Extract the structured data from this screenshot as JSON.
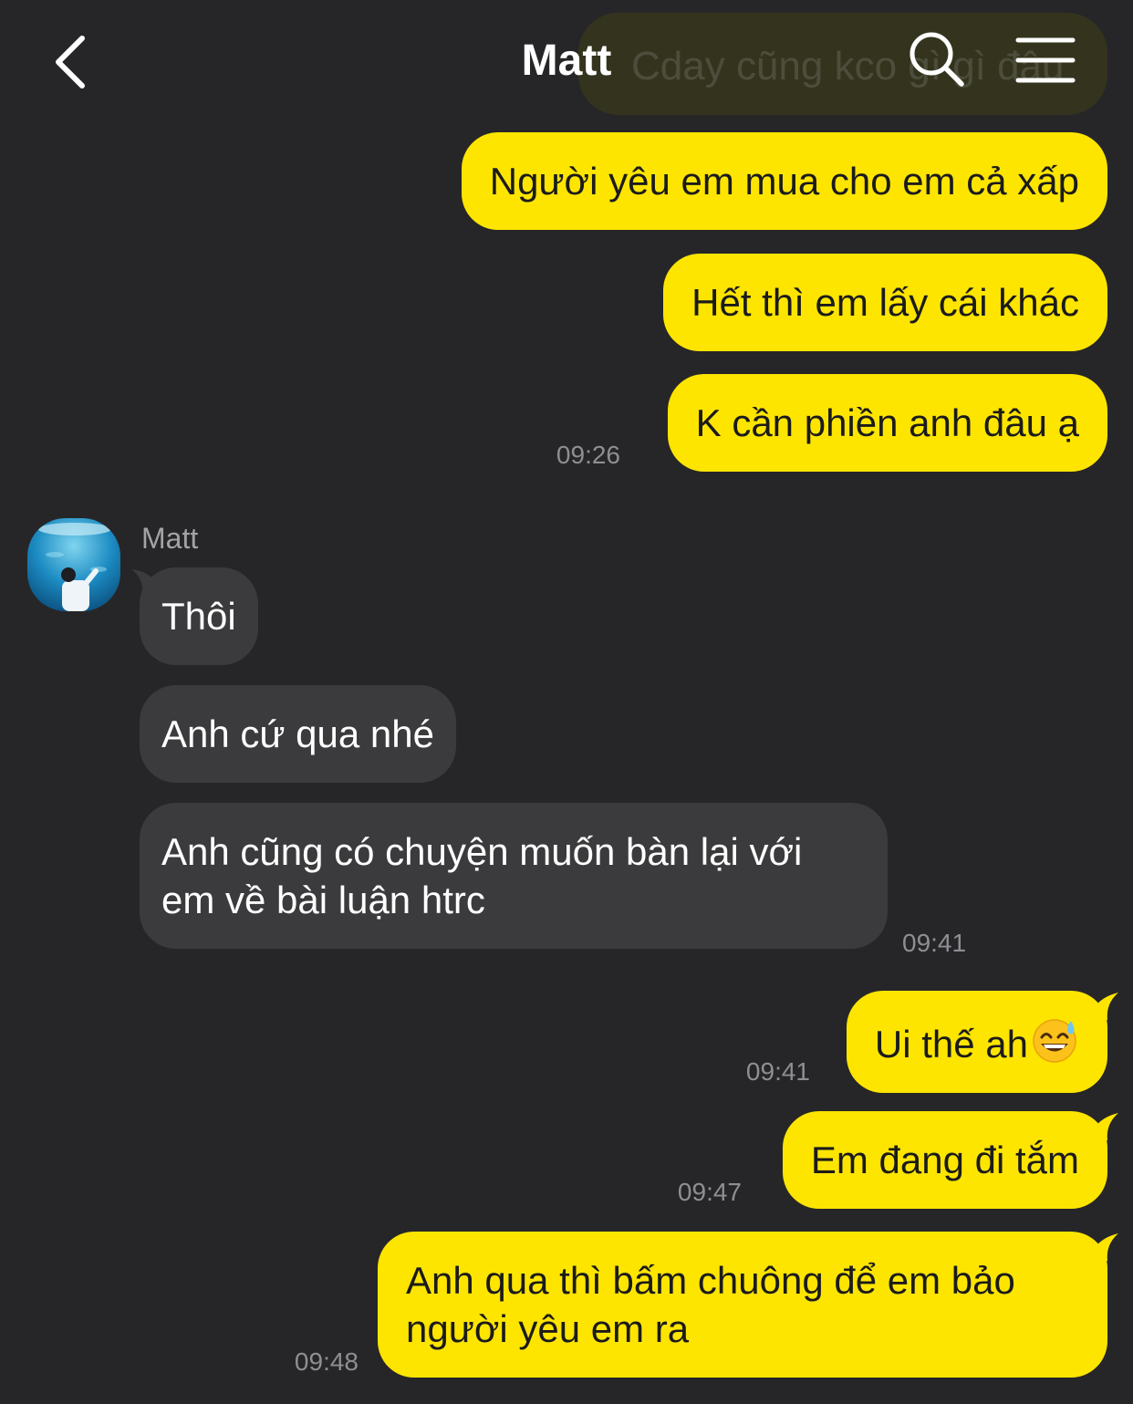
{
  "header": {
    "title": "Matt",
    "partial_message": "Cday cũng kco gì gì đâu"
  },
  "contact": {
    "name": "Matt"
  },
  "messages": [
    {
      "text": "Người yêu em mua cho em cả xấp"
    },
    {
      "text": "Hết thì em lấy cái khác"
    },
    {
      "text": "K cần phiền anh đâu ạ",
      "time": "09:26"
    },
    {
      "text": "Thôi"
    },
    {
      "text": "Anh cứ qua nhé"
    },
    {
      "line1": "Anh cũng có chuyện muốn bàn lại với",
      "line2": "em về bài luận htrc",
      "time": "09:41"
    },
    {
      "text": "Ui thế ah",
      "emoji": "sweat-smile-emoji",
      "time": "09:41"
    },
    {
      "text": "Em đang đi tắm",
      "time": "09:47"
    },
    {
      "line1": "Anh qua thì bấm chuông để em bảo",
      "line2": "người yêu em ra",
      "time": "09:48"
    }
  ],
  "colors": {
    "background": "#262628",
    "outgoing_bubble": "#fee500",
    "incoming_bubble": "#3b3b3d",
    "timestamp": "#8e8e93"
  },
  "icons": {
    "back": "chevron-left-icon",
    "search": "search-icon",
    "menu": "hamburger-menu-icon"
  }
}
